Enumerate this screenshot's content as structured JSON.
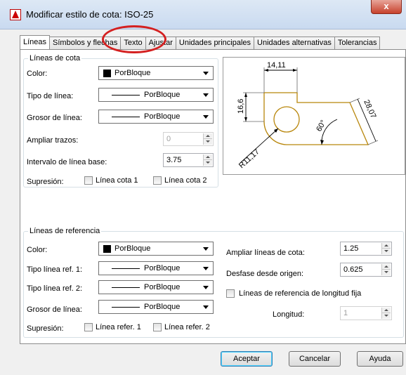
{
  "window": {
    "title": "Modificar estilo de cota: ISO-25",
    "close_label": "x"
  },
  "tabs": [
    {
      "label": "Líneas",
      "active": true
    },
    {
      "label": "Símbolos y flechas"
    },
    {
      "label": "Texto"
    },
    {
      "label": "Ajustar"
    },
    {
      "label": "Unidades principales"
    },
    {
      "label": "Unidades alternativas"
    },
    {
      "label": "Tolerancias"
    }
  ],
  "dim_lines": {
    "title": "Líneas de cota",
    "color_label": "Color:",
    "color_value": "PorBloque",
    "linetype_label": "Tipo de línea:",
    "linetype_value": "PorBloque",
    "lineweight_label": "Grosor de línea:",
    "lineweight_value": "PorBloque",
    "extend_label": "Ampliar trazos:",
    "extend_value": "0",
    "baseline_label": "Intervalo de línea base:",
    "baseline_value": "3.75",
    "suppress_label": "Supresión:",
    "suppress_1": "Línea cota 1",
    "suppress_2": "Línea cota 2"
  },
  "preview": {
    "dim_top": "14,11",
    "dim_left": "16,6",
    "dim_right": "28,07",
    "angle": "60°",
    "radius": "R11,17",
    "line_color": "#b8860b"
  },
  "ext_lines": {
    "title": "Líneas de referencia",
    "color_label": "Color:",
    "color_value": "PorBloque",
    "linetype1_label": "Tipo línea ref. 1:",
    "linetype1_value": "PorBloque",
    "linetype2_label": "Tipo línea ref. 2:",
    "linetype2_value": "PorBloque",
    "lineweight_label": "Grosor de línea:",
    "lineweight_value": "PorBloque",
    "suppress_label": "Supresión:",
    "suppress_1": "Línea refer. 1",
    "suppress_2": "Línea refer. 2",
    "extend_label": "Ampliar líneas de cota:",
    "extend_value": "1.25",
    "offset_label": "Desfase desde origen:",
    "offset_value": "0.625",
    "fixed_label": "Líneas de referencia de longitud fija",
    "length_label": "Longitud:",
    "length_value": "1"
  },
  "buttons": {
    "ok": "Aceptar",
    "cancel": "Cancelar",
    "help": "Ayuda"
  }
}
